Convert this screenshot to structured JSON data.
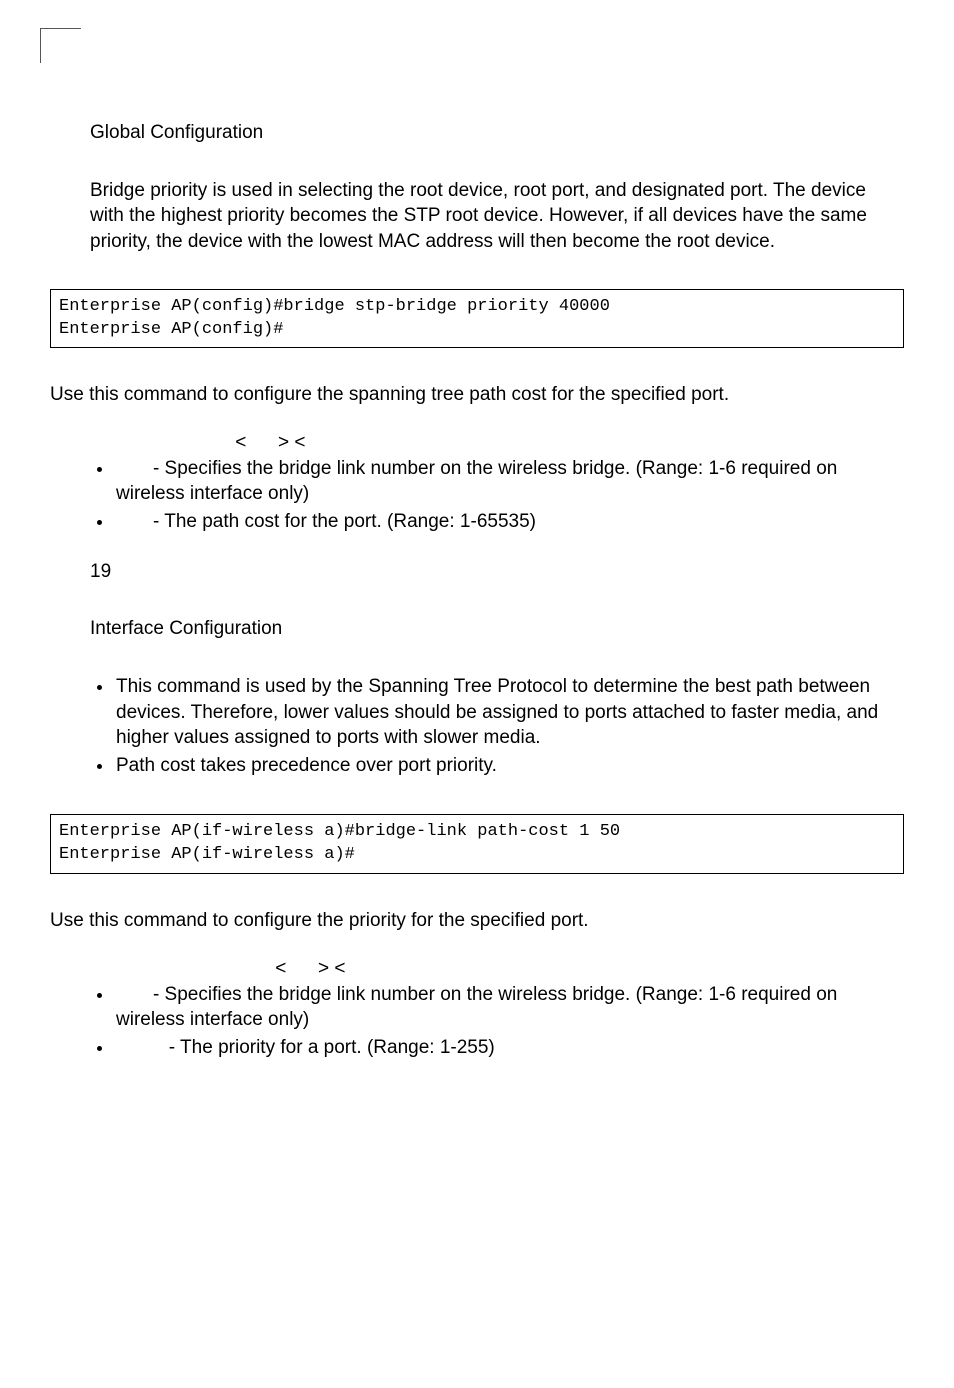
{
  "top": {
    "command_mode": "Global Configuration",
    "desc": "Bridge priority is used in selecting the root device, root port, and designated port. The device with the highest priority becomes the STP root device. However, if all devices have the same priority, the device with the lowest MAC address will then become the root device.",
    "code": "Enterprise AP(config)#bridge stp-bridge priority 40000\nEnterprise AP(config)#"
  },
  "pathcost": {
    "intro": "Use this command to configure the spanning tree path cost for the specified port.",
    "syntax": " <      > < ",
    "bullet1_text": "       - Specifies the bridge link number on the wireless bridge. (Range: 1-6 required on wireless interface only)",
    "bullet2_text": "       - The path cost for the port. (Range: 1-65535)",
    "default_val": "19",
    "command_mode": "Interface Configuration",
    "bullet3_text": "This command is used by the Spanning Tree Protocol to determine the best path between devices. Therefore, lower values should be assigned to ports attached to faster media, and higher values assigned to ports with slower media.",
    "bullet4_text": "Path cost takes precedence over port priority.",
    "code": "Enterprise AP(if-wireless a)#bridge-link path-cost 1 50\nEnterprise AP(if-wireless a)#"
  },
  "priority": {
    "intro": "Use this command to configure the priority for the specified port.",
    "syntax": " <      > < ",
    "bullet1_text": "       - Specifies the bridge link number on the wireless bridge. (Range: 1-6 required on wireless interface only)",
    "bullet2_text": "          - The priority for a port. (Range: 1-255)"
  }
}
